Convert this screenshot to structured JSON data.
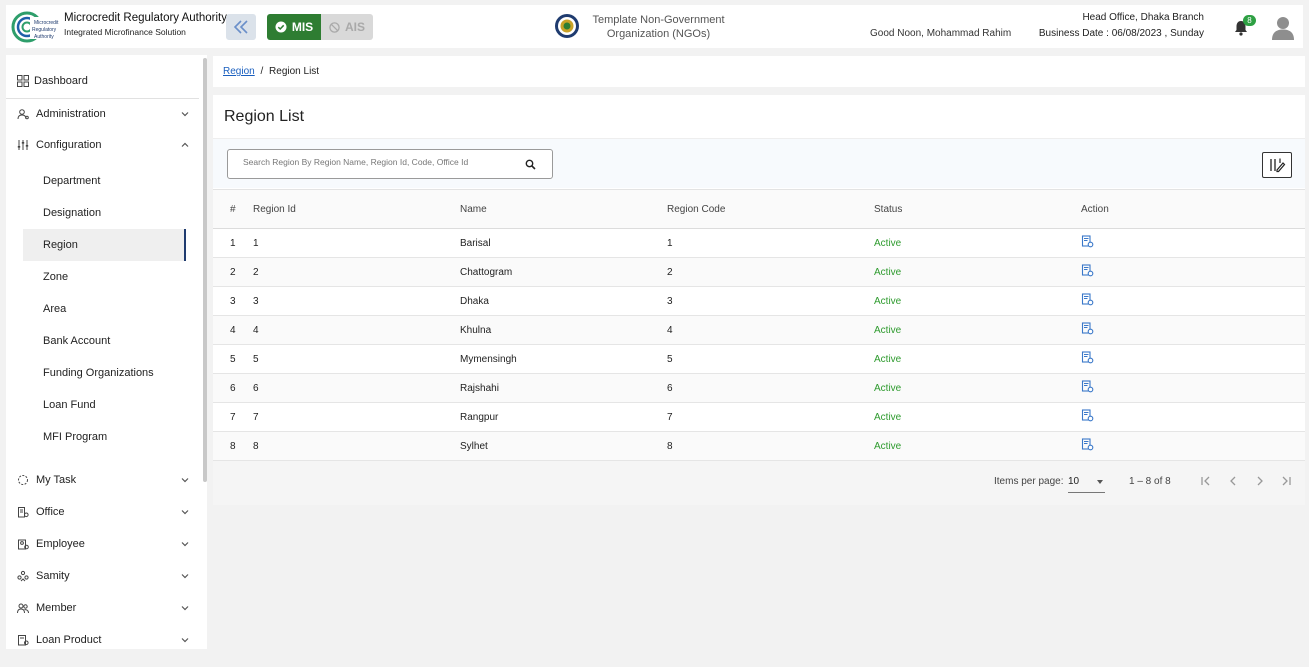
{
  "header": {
    "brand_title": "Microcredit Regulatory Authority",
    "brand_subtitle": "Integrated Microfinance Solution",
    "logo_text": [
      "Microcredit",
      "Regulatory",
      "Authority"
    ],
    "module_mis": "MIS",
    "module_ais": "AIS",
    "org_name_line1": "Template Non-Government",
    "org_name_line2": "Organization (NGOs)",
    "greeting": "Good Noon, Mohammad Rahim",
    "branch": "Head Office, Dhaka Branch",
    "business_date": "Business Date : 06/08/2023 , Sunday",
    "notification_count": "8",
    "colors": {
      "mis_green": "#2e7d32",
      "badge_green": "#2ea043"
    }
  },
  "sidebar": {
    "dashboard": "Dashboard",
    "items": [
      {
        "label": "Administration",
        "icon": "users-gear-icon",
        "expanded": false
      },
      {
        "label": "Configuration",
        "icon": "sliders-icon",
        "expanded": true
      }
    ],
    "config_subitems": [
      "Department",
      "Designation",
      "Region",
      "Zone",
      "Area",
      "Bank Account",
      "Funding Organizations",
      "Loan Fund",
      "MFI Program"
    ],
    "active_subitem": "Region",
    "lower_items": [
      {
        "label": "My Task",
        "icon": "task-icon"
      },
      {
        "label": "Office",
        "icon": "office-icon"
      },
      {
        "label": "Employee",
        "icon": "employee-icon"
      },
      {
        "label": "Samity",
        "icon": "samity-icon"
      },
      {
        "label": "Member",
        "icon": "member-icon"
      },
      {
        "label": "Loan Product",
        "icon": "loan-product-icon"
      }
    ]
  },
  "breadcrumb": {
    "parent": "Region",
    "separator": "/",
    "current": "Region List"
  },
  "main": {
    "title": "Region List",
    "search_placeholder": "Search Region By Region Name, Region Id, Code, Office Id",
    "table": {
      "headers": [
        "#",
        "Region Id",
        "Name",
        "Region Code",
        "Status",
        "Action"
      ],
      "rows": [
        {
          "index": "1",
          "id": "1",
          "name": "Barisal",
          "code": "1",
          "status": "Active"
        },
        {
          "index": "2",
          "id": "2",
          "name": "Chattogram",
          "code": "2",
          "status": "Active"
        },
        {
          "index": "3",
          "id": "3",
          "name": "Dhaka",
          "code": "3",
          "status": "Active"
        },
        {
          "index": "4",
          "id": "4",
          "name": "Khulna",
          "code": "4",
          "status": "Active"
        },
        {
          "index": "5",
          "id": "5",
          "name": "Mymensingh",
          "code": "5",
          "status": "Active"
        },
        {
          "index": "6",
          "id": "6",
          "name": "Rajshahi",
          "code": "6",
          "status": "Active"
        },
        {
          "index": "7",
          "id": "7",
          "name": "Rangpur",
          "code": "7",
          "status": "Active"
        },
        {
          "index": "8",
          "id": "8",
          "name": "Sylhet",
          "code": "8",
          "status": "Active"
        }
      ]
    },
    "paginator": {
      "items_per_page_label": "Items per page:",
      "page_size": "10",
      "range": "1 – 8 of 8"
    }
  }
}
